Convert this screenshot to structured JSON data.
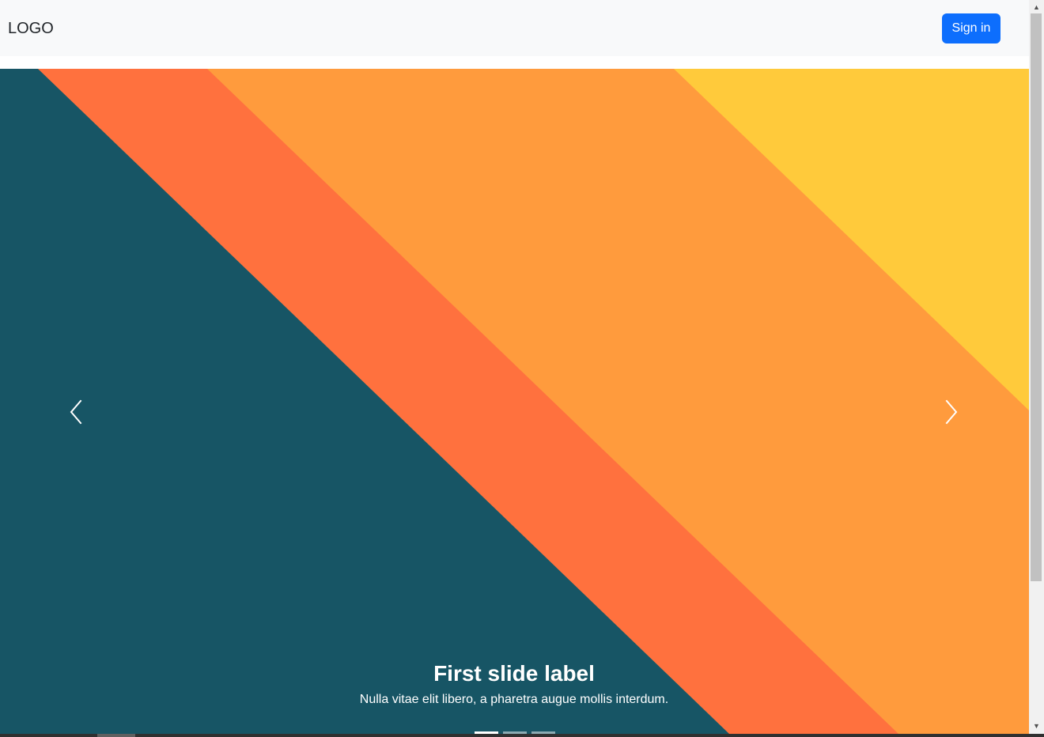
{
  "navbar": {
    "brand": "LOGO",
    "sign_in_label": "Sign in",
    "background_color": "#f8f9fa",
    "button_color": "#0d6efd"
  },
  "carousel": {
    "caption_title": "First slide label",
    "caption_text": "Nulla vitae elit libero, a pharetra augue mollis interdum.",
    "controls": {
      "previous_icon": "chevron-left-icon",
      "next_icon": "chevron-right-icon"
    },
    "indicators": [
      {
        "active": true
      },
      {
        "active": false
      },
      {
        "active": false
      }
    ],
    "colors": {
      "teal": "#175565",
      "coral": "#ff713e",
      "orange": "#ff9b3d",
      "yellow": "#ffca3b"
    }
  },
  "scrollbar": {
    "up_icon": "▲",
    "down_icon": "▼"
  }
}
